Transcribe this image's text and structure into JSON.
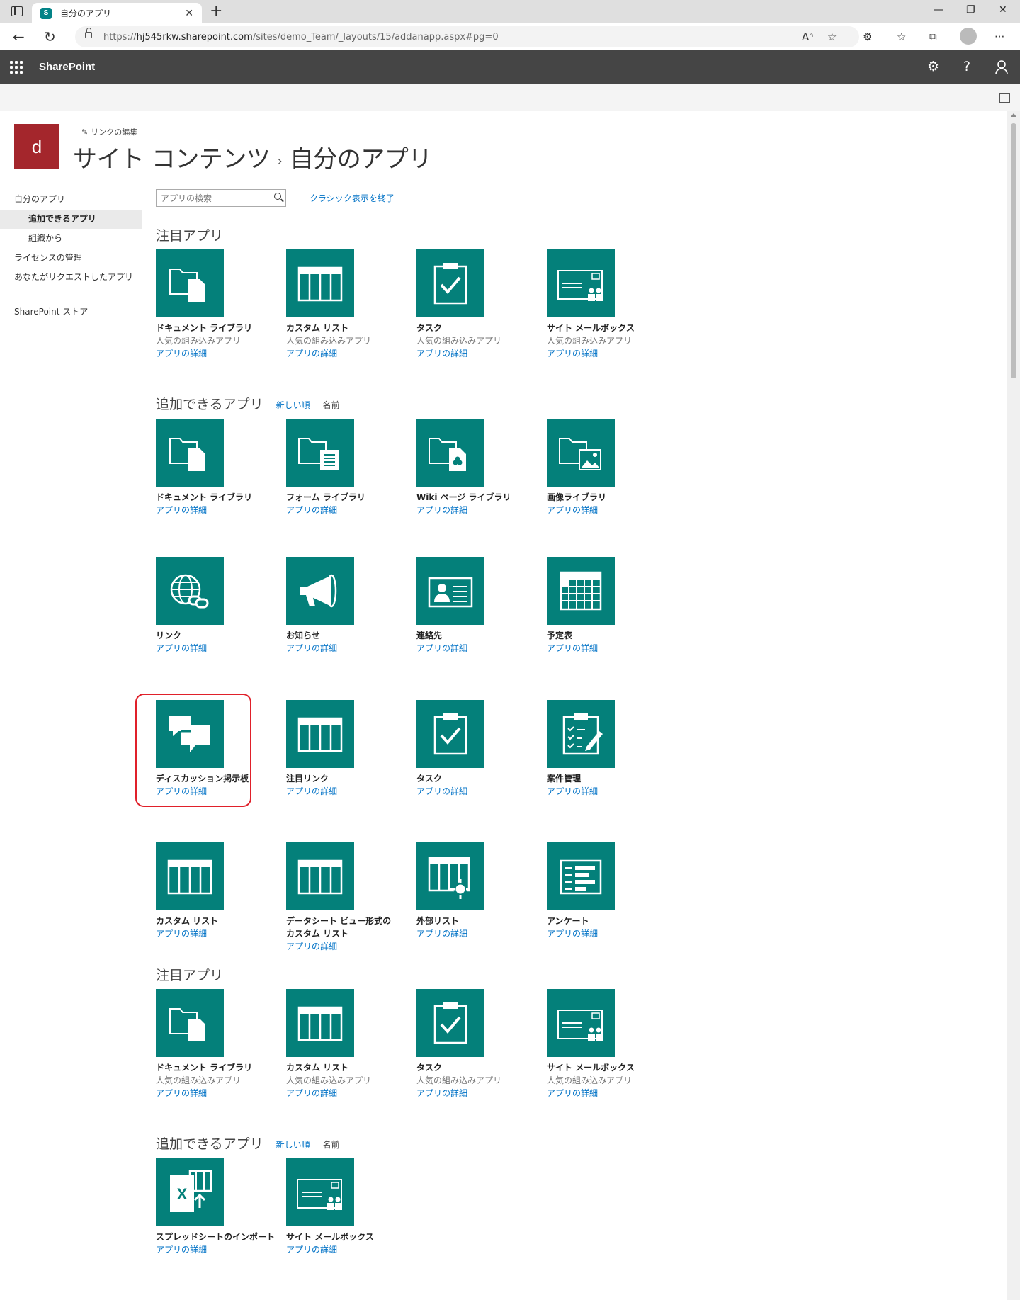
{
  "browser": {
    "tab_title": "自分のアプリ",
    "tab_close": "✕",
    "new_tab": "+",
    "favicon_letter": "S",
    "url_prefix": "https://",
    "url_host": "hj545rkw.sharepoint.com",
    "url_path": "/sites/demo_Team/_layouts/15/addanapp.aspx#pg=0",
    "win_min": "—",
    "win_max": "❐",
    "win_close": "✕",
    "back": "←",
    "refresh": "↻",
    "read_aloud": "Aʰ",
    "fav_add": "☆",
    "extensions": "⚙",
    "favorites": "☆",
    "collections": "⧉",
    "more": "···"
  },
  "suite": {
    "brand": "SharePoint",
    "settings": "⚙",
    "help": "?",
    "user": "⚲"
  },
  "site": {
    "logo_letter": "d",
    "edit_links": "リンクの編集",
    "title_part1": "サイト コンテンツ",
    "title_sep": "›",
    "title_part2": "自分のアプリ"
  },
  "leftnav": [
    {
      "label": "自分のアプリ"
    },
    {
      "label": "追加できるアプリ"
    },
    {
      "label": "組織から"
    },
    {
      "label": "ライセンスの管理"
    },
    {
      "label": "あなたがリクエストしたアプリ"
    },
    {
      "label": "SharePoint ストア"
    }
  ],
  "search": {
    "placeholder": "アプリの検索"
  },
  "classic_exit": "クラシック表示を終了",
  "sections": {
    "featured": "注目アプリ",
    "addable": "追加できるアプリ",
    "sort_new": "新しい順",
    "sort_name": "名前"
  },
  "tiles": {
    "desc_popular": "人気の組み込みアプリ",
    "details": "アプリの詳細",
    "doclib": "ドキュメント ライブラリ",
    "customlist": "カスタム リスト",
    "task": "タスク",
    "sitemailbox": "サイト メールボックス",
    "formlib": "フォーム ライブラリ",
    "wikilib": "Wiki ページ ライブラリ",
    "picturelib": "画像ライブラリ",
    "links": "リンク",
    "announcements": "お知らせ",
    "contacts": "連絡先",
    "calendar": "予定表",
    "discussion": "ディスカッション掲示板",
    "promoted": "注目リンク",
    "issue": "案件管理",
    "datasheet_l1": "データシート ビュー形式の",
    "datasheet_l2": "カスタム リスト",
    "external": "外部リスト",
    "survey": "アンケート",
    "import": "スプレッドシートのインポート"
  }
}
